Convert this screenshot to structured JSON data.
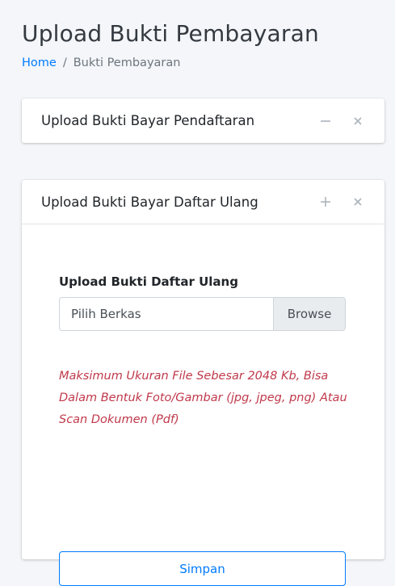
{
  "page": {
    "title": "Upload Bukti Pembayaran",
    "breadcrumb": {
      "home": "Home",
      "separator": "/",
      "current": "Bukti Pembayaran"
    }
  },
  "cards": {
    "registration": {
      "title": "Upload Bukti Bayar Pendaftaran",
      "collapse_icon": "minus-icon",
      "close_icon": "close-icon"
    },
    "re_registration": {
      "title": "Upload Bukti Bayar Daftar Ulang",
      "expand_icon": "plus-icon",
      "close_icon": "close-icon",
      "form_label": "Upload Bukti Daftar Ulang",
      "file_placeholder": "Pilih Berkas",
      "browse_label": "Browse",
      "help_text": "Maksimum Ukuran File Sebesar 2048 Kb, Bisa Dalam Bentuk Foto/Gambar (jpg, jpeg, png) Atau Scan Dokumen (Pdf)",
      "submit_label": "Simpan"
    }
  },
  "colors": {
    "background": "#f4f6f9",
    "primary": "#007bff",
    "danger_text": "#c0394b",
    "muted_icon": "#adb5bd"
  }
}
